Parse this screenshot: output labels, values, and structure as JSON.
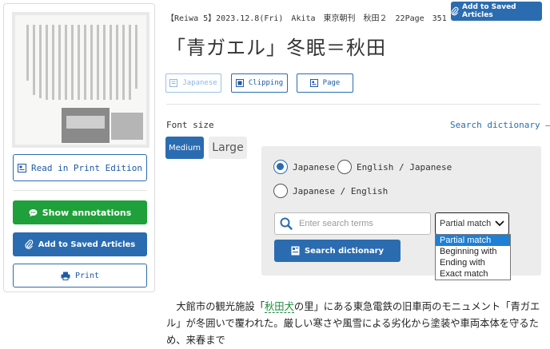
{
  "left_panel": {
    "read_print_edition_label": "Read in Print Edition",
    "show_annotations_label": "Show annotations",
    "add_saved_label": "Add to Saved Articles",
    "print_label": "Print"
  },
  "header": {
    "add_saved_label": "Add to Saved Articles",
    "meta": "【Reiwa 5】2023.12.8(Fri)　Akita　東京朝刊　秋田２　22Page　351",
    "title": "「青ガエル」冬眠＝秋田"
  },
  "tabs": [
    {
      "label": "Japanese",
      "disabled": true
    },
    {
      "label": "Clipping",
      "disabled": false
    },
    {
      "label": "Page",
      "disabled": false
    }
  ],
  "font_size": {
    "label": "Font size",
    "medium": "Medium",
    "large": "Large",
    "selected": "Medium"
  },
  "dictionary": {
    "link_label": "Search dictionary ―",
    "radios": [
      {
        "label": "Japanese",
        "checked": true
      },
      {
        "label": "English / Japanese",
        "checked": false
      },
      {
        "label": "Japanese / English",
        "checked": false
      }
    ],
    "search_placeholder": "Enter search terms",
    "match_selected": "Partial match",
    "match_options": [
      "Partial match",
      "Beginning with",
      "Ending with",
      "Exact match"
    ],
    "search_button_label": "Search dictionary"
  },
  "article": {
    "p1_a": "大館市の観光施設「",
    "p1_kw": "秋田犬",
    "p1_b": "の里」にある東急電鉄の旧車両のモニュメント「青ガエル」が冬囲いで覆われた。厳しい寒さや風雪による劣化から塗装や車両本体を守るため、来春まで"
  },
  "colors": {
    "accent": "#2b6cb0",
    "green": "#1fa03a",
    "dropdown_highlight": "#1e7fd6"
  }
}
